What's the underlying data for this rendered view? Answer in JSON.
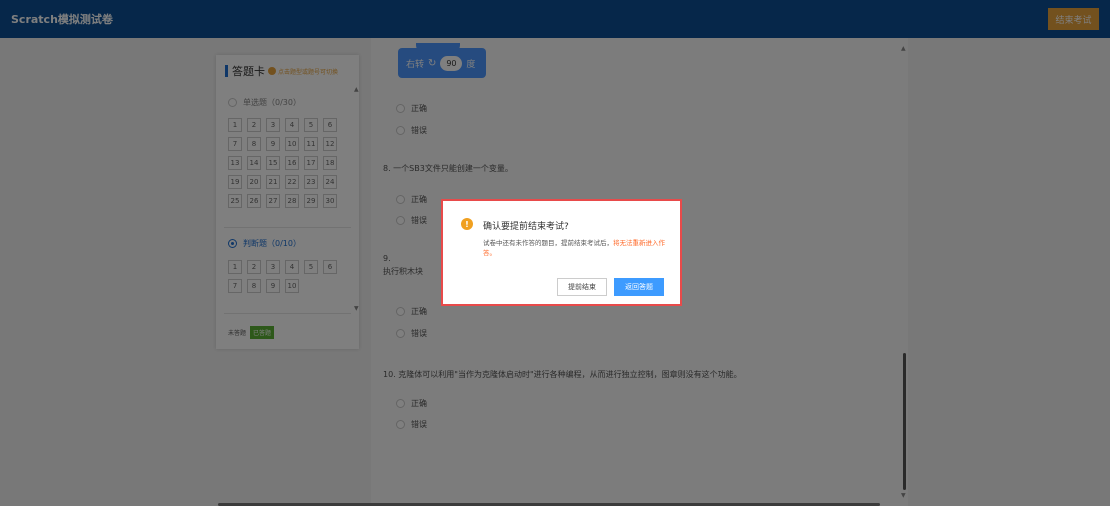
{
  "header": {
    "title": "Scratch模拟测试卷",
    "end_button": "结束考试"
  },
  "answer_card": {
    "title": "答题卡",
    "hint": "点击题型或题号可切换",
    "single": {
      "label": "单选题（0/30）",
      "numbers": [
        "1",
        "2",
        "3",
        "4",
        "5",
        "6",
        "7",
        "8",
        "9",
        "10",
        "11",
        "12",
        "13",
        "14",
        "15",
        "16",
        "17",
        "18",
        "19",
        "20",
        "21",
        "22",
        "23",
        "24",
        "25",
        "26",
        "27",
        "28",
        "29",
        "30"
      ]
    },
    "judge": {
      "label": "判断题（0/10）",
      "numbers": [
        "1",
        "2",
        "3",
        "4",
        "5",
        "6",
        "7",
        "8",
        "9",
        "10"
      ]
    },
    "legend": {
      "unanswered": "未答题",
      "answered": "已答题"
    }
  },
  "block": {
    "text": "右转",
    "icon": "rotate-right-icon",
    "value": "90",
    "unit": "度"
  },
  "options": {
    "true_label": "正确",
    "false_label": "错误"
  },
  "questions": {
    "q8": "8.  一个SB3文件只能创建一个变量。",
    "q9_num": "9.",
    "q9_text": "执行积木块",
    "q10": "10. 克隆体可以利用\"当作为克隆体启动时\"进行各种编程，从而进行独立控制，图章则没有这个功能。"
  },
  "dialog": {
    "icon": "warning-icon",
    "icon_glyph": "!",
    "title": "确认要提前结束考试?",
    "message": "试卷中还有未作答的题目，提前结束考试后，",
    "warning": "将无法重新进入作答。",
    "cancel": "提前结束",
    "confirm": "返回答题"
  },
  "colors": {
    "header": "#0d4f95",
    "end_button": "#e6a23c",
    "primary": "#3d9bff",
    "warning": "#ff6a2a",
    "answered": "#5ab035"
  }
}
